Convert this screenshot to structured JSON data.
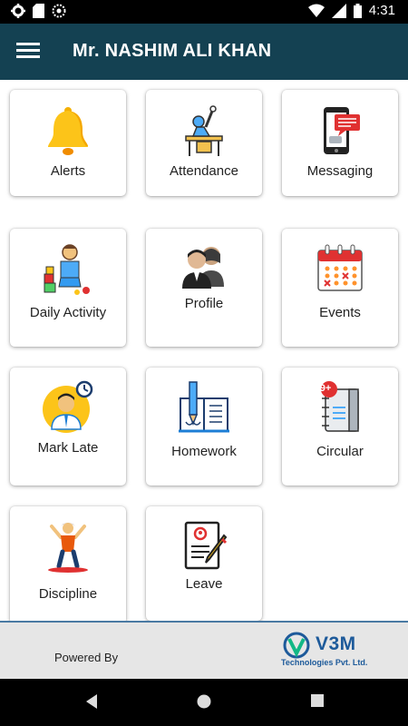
{
  "status_bar": {
    "time": "4:31",
    "icons": [
      "gear-icon",
      "sd-card-icon",
      "sync-icon",
      "wifi-icon",
      "signal-icon",
      "battery-icon"
    ]
  },
  "app_bar": {
    "title": "Mr. NASHIM ALI KHAN",
    "menu_icon": "hamburger-menu-icon"
  },
  "tiles": [
    {
      "label": "Alerts",
      "icon": "bell-icon"
    },
    {
      "label": "Attendance",
      "icon": "attendance-desk-icon"
    },
    {
      "label": "Messaging",
      "icon": "phone-message-icon"
    },
    {
      "label": "Daily Activity",
      "icon": "child-playing-icon"
    },
    {
      "label": "Profile",
      "icon": "profile-people-icon"
    },
    {
      "label": "Events",
      "icon": "calendar-icon"
    },
    {
      "label": "Mark Late",
      "icon": "student-clock-icon"
    },
    {
      "label": "Homework",
      "icon": "book-pencil-icon"
    },
    {
      "label": "Circular",
      "icon": "notebook-badge-icon"
    },
    {
      "label": "Discipline",
      "icon": "person-exercise-icon"
    },
    {
      "label": "Leave",
      "icon": "leave-document-icon"
    }
  ],
  "circular_badge": "9+",
  "footer": {
    "powered_by": "Powered By",
    "brand": "V3M",
    "brand_sub": "Technologies Pvt. Ltd."
  },
  "colors": {
    "app_bar": "#144152",
    "brand": "#1d5a9a",
    "footer_bg": "#e6e6e6"
  }
}
